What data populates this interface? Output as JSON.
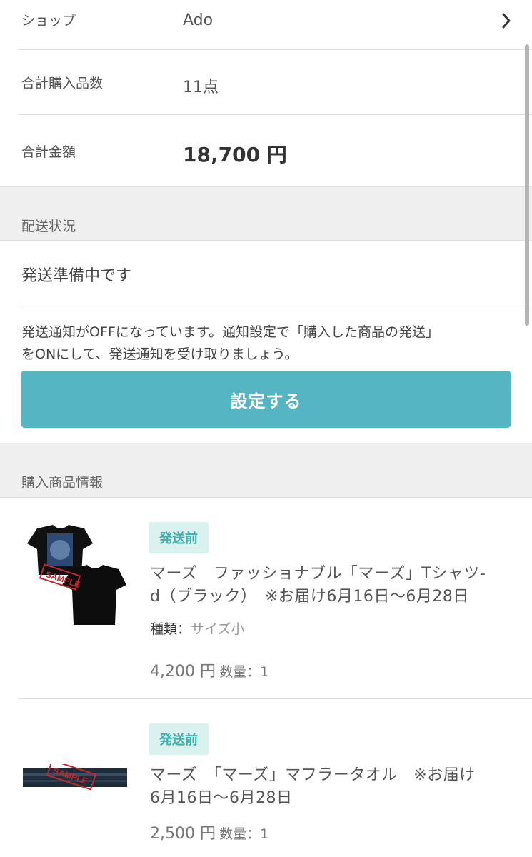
{
  "summary": {
    "shop_label": "ショップ",
    "shop_value": "Ado",
    "count_label": "合計購入品数",
    "count_value": "11点",
    "total_label": "合計金額",
    "total_value": "18,700 円"
  },
  "shipping": {
    "section_title": "配送状況",
    "status": "発送準備中です",
    "notice_line1": "発送通知がOFFになっています。通知設定で「購入した商品の発送」",
    "notice_line2": "をONにして、発送通知を受け取りましょう。",
    "button_label": "設定する"
  },
  "items_section": {
    "title": "購入商品情報",
    "items": [
      {
        "badge": "発送前",
        "title_line1": "マーズ　ファッショナブル「マーズ」Tシャツ-",
        "title_line2": "d（ブラック）　※お届け6月16日～6月28日",
        "variant_label": "種類：",
        "variant_value": "サイズ小",
        "price": "4,200 円",
        "qty": "数量：1",
        "image_stamp": "SAMPLE"
      },
      {
        "badge": "発送前",
        "title_line1": "マーズ　「マーズ」マフラータオル　※お届け",
        "title_line2": "6月16日～6月28日",
        "price": "2,500 円",
        "qty": "数量：1",
        "image_stamp": "SAMPLE"
      }
    ]
  }
}
